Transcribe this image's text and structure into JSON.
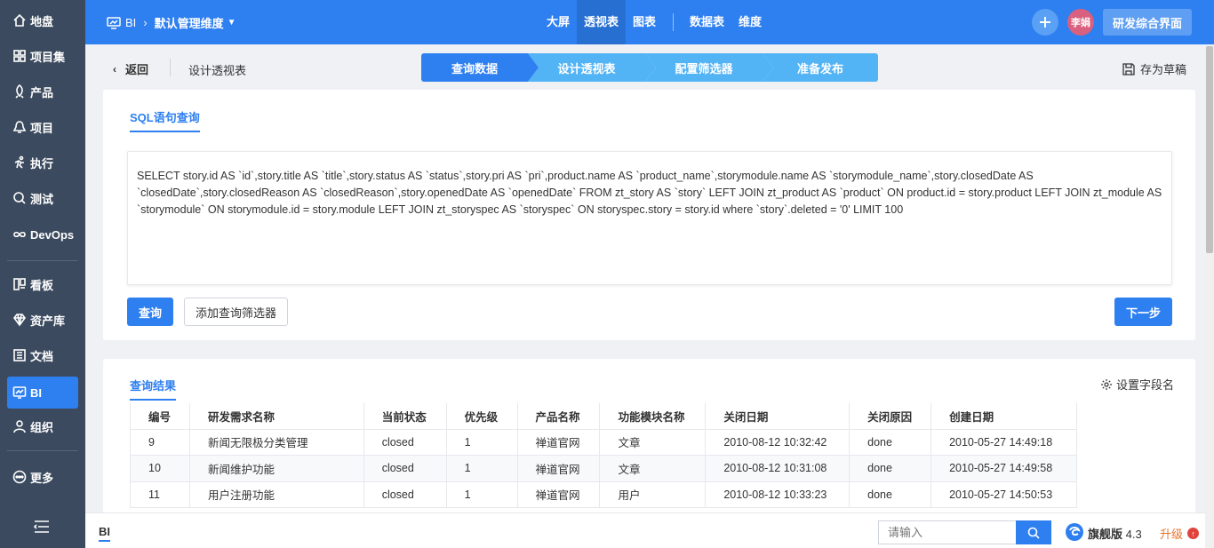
{
  "sidebar": {
    "items": [
      {
        "label": "地盘",
        "icon": "home-icon"
      },
      {
        "label": "项目集",
        "icon": "grid-icon"
      },
      {
        "label": "产品",
        "icon": "product-icon"
      },
      {
        "label": "项目",
        "icon": "project-icon"
      },
      {
        "label": "执行",
        "icon": "run-icon"
      },
      {
        "label": "测试",
        "icon": "test-icon"
      },
      {
        "label": "DevOps",
        "icon": "infinity-icon"
      },
      {
        "label": "看板",
        "icon": "kanban-icon"
      },
      {
        "label": "资产库",
        "icon": "diamond-icon"
      },
      {
        "label": "文档",
        "icon": "doc-icon"
      },
      {
        "label": "BI",
        "icon": "monitor-icon",
        "active": true
      },
      {
        "label": "组织",
        "icon": "user-icon"
      },
      {
        "label": "更多",
        "icon": "more-icon"
      }
    ]
  },
  "topbar": {
    "app": "BI",
    "project": "默认管理维度",
    "nav": [
      "大屏",
      "透视表",
      "图表",
      "数据表",
      "维度"
    ],
    "active_nav": "透视表",
    "avatar": "李娟",
    "switch_label": "研发综合界面"
  },
  "subheader": {
    "back": "返回",
    "title": "设计透视表",
    "steps": [
      "查询数据",
      "设计透视表",
      "配置筛选器",
      "准备发布"
    ],
    "draft": "存为草稿"
  },
  "sql_panel": {
    "tab": "SQL语句查询",
    "query": "SELECT story.id AS `id`,story.title AS `title`,story.status AS `status`,story.pri AS `pri`,product.name AS `product_name`,storymodule.name AS `storymodule_name`,story.closedDate AS `closedDate`,story.closedReason AS `closedReason`,story.openedDate AS `openedDate` FROM zt_story AS `story`  LEFT JOIN zt_product AS `product` ON product.id = story.product  LEFT JOIN zt_module AS `storymodule` ON storymodule.id = story.module  LEFT JOIN zt_storyspec AS `storyspec` ON storyspec.story = story.id where `story`.deleted = '0' LIMIT 100",
    "query_btn": "查询",
    "filter_btn": "添加查询筛选器",
    "next_btn": "下一步"
  },
  "result": {
    "tab": "查询结果",
    "field_btn": "设置字段名",
    "columns": [
      "编号",
      "研发需求名称",
      "当前状态",
      "优先级",
      "产品名称",
      "功能模块名称",
      "关闭日期",
      "关闭原因",
      "创建日期"
    ],
    "rows": [
      [
        "9",
        "新闻无限极分类管理",
        "closed",
        "1",
        "禅道官网",
        "文章",
        "2010-08-12 10:32:42",
        "done",
        "2010-05-27 14:49:18"
      ],
      [
        "10",
        "新闻维护功能",
        "closed",
        "1",
        "禅道官网",
        "文章",
        "2010-08-12 10:31:08",
        "done",
        "2010-05-27 14:49:58"
      ],
      [
        "11",
        "用户注册功能",
        "closed",
        "1",
        "禅道官网",
        "用户",
        "2010-08-12 10:33:23",
        "done",
        "2010-05-27 14:50:53"
      ]
    ]
  },
  "footer": {
    "tab": "BI",
    "search_placeholder": "请输入",
    "edition": "旗舰版",
    "version": "4.3",
    "upgrade": "升级"
  },
  "colors": {
    "primary": "#2e7ff0",
    "sidebar": "#3b4a5e",
    "step_inactive": "#52b3f5"
  }
}
